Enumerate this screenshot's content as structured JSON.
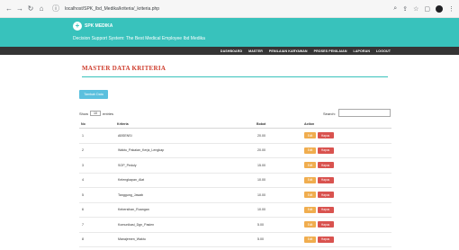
{
  "browser": {
    "url": "localhost/SPK_Ibd_Medika/kriteria/_kriteria.php"
  },
  "site": {
    "logo_text": "SPK MEDIKA",
    "tagline": "Decision Support System: The Best Medical Employee Ibd Medika",
    "menu": [
      {
        "label": "DASHBOARD"
      },
      {
        "label": "MASTER"
      },
      {
        "label": "PENILAIAN KARYAWAN"
      },
      {
        "label": "PROSES PENILAIAN"
      },
      {
        "label": "LAPORAN"
      },
      {
        "label": "LOGOUT"
      }
    ],
    "accent": "#38c2bc",
    "title_color": "#ce3c2c"
  },
  "page": {
    "title": "MASTER DATA KRITERIA",
    "add_button": "Tambah Data",
    "show_prefix": "Show",
    "show_value": "10",
    "show_suffix": "entries",
    "search_label": "Search:",
    "search_value": ""
  },
  "table": {
    "headers": {
      "no": "No",
      "kriteria": "Kriteria",
      "bobot": "Bobot",
      "aksi": "Action"
    },
    "edit_label": "Edit",
    "delete_label": "Hapus",
    "rows": [
      {
        "no": "1",
        "kriteria": "ABSENSI",
        "bobot": "20.00"
      },
      {
        "no": "2",
        "kriteria": "Waktu_Pakaian_Kerja_Lengkap",
        "bobot": "20.00"
      },
      {
        "no": "3",
        "kriteria": "SOP_Peduly",
        "bobot": "15.00"
      },
      {
        "no": "4",
        "kriteria": "Kelengkapan_Alat",
        "bobot": "10.00"
      },
      {
        "no": "5",
        "kriteria": "Tanggung_Jawab",
        "bobot": "10.00"
      },
      {
        "no": "6",
        "kriteria": "Kebersihan_Ruangan",
        "bobot": "10.00"
      },
      {
        "no": "7",
        "kriteria": "Komunikasi_Dgn_Pasien",
        "bobot": "5.00"
      },
      {
        "no": "8",
        "kriteria": "Manajemen_Waktu",
        "bobot": "5.00"
      }
    ]
  }
}
